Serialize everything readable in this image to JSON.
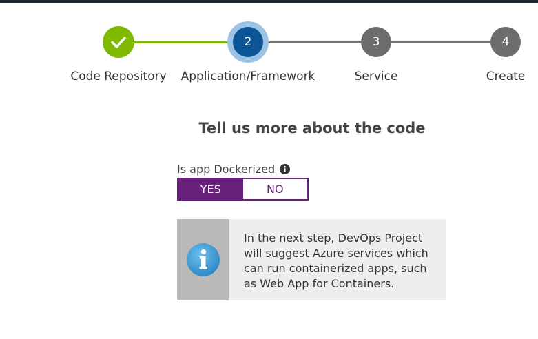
{
  "stepper": {
    "steps": [
      {
        "number": "",
        "label": "Code Repository",
        "status": "completed"
      },
      {
        "number": "2",
        "label": "Application/Framework",
        "status": "current"
      },
      {
        "number": "3",
        "label": "Service",
        "status": "upcoming"
      },
      {
        "number": "4",
        "label": "Create",
        "status": "upcoming"
      }
    ]
  },
  "main": {
    "title": "Tell us more about the code",
    "dockerized": {
      "label": "Is app Dockerized",
      "options": [
        "YES",
        "NO"
      ],
      "selected": "YES"
    },
    "info_box": {
      "text": "In the next step, DevOps Project will suggest Azure services which can run containerized apps, such as Web App for Containers."
    }
  },
  "colors": {
    "completed": "#7fba00",
    "current": "#0d5497",
    "current_ring": "#9cc3e6",
    "upcoming": "#6d6d6d",
    "toggle_accent": "#68217a",
    "info_icon": "#3a9bd9"
  },
  "icons": {
    "step_completed": "checkmark-icon",
    "field_info": "info-icon",
    "info_box": "info-circle-icon"
  }
}
